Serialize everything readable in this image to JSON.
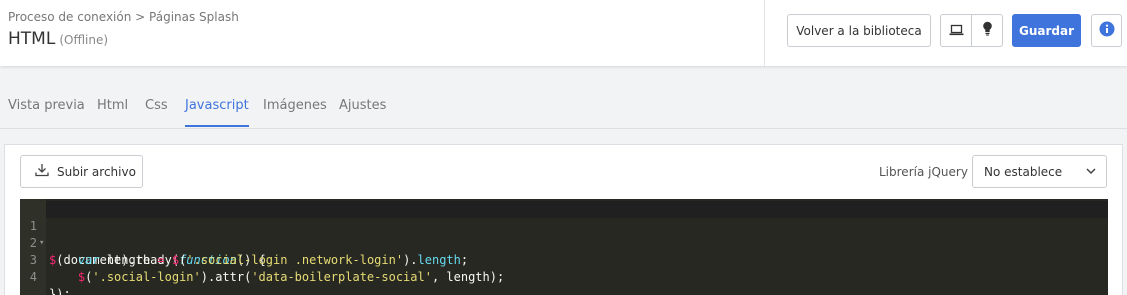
{
  "header": {
    "breadcrumb": "Proceso de conexión > Páginas Splash",
    "title": "HTML",
    "subtitle": "(Offline)",
    "library_button": "Volver a la biblioteca",
    "save_button": "Guardar",
    "icons": [
      "laptop-icon",
      "lightbulb-icon",
      "info-icon"
    ]
  },
  "tabs": [
    {
      "label": "Vista previa",
      "active": false
    },
    {
      "label": "Html",
      "active": false
    },
    {
      "label": "Css",
      "active": false
    },
    {
      "label": "Javascript",
      "active": true
    },
    {
      "label": "Imágenes",
      "active": false
    },
    {
      "label": "Ajustes",
      "active": false
    }
  ],
  "toolbar": {
    "upload_label": "Subir archivo",
    "jquery_label": "Librería jQuery",
    "jquery_selected": "No establece"
  },
  "editor": {
    "line_numbers": [
      "1",
      "2",
      "3",
      "4"
    ],
    "lines": [
      "$(document).ready(function() {",
      "    var length = $('.social-login .network-login').length;",
      "    $('.social-login').attr('data-boilerplate-social', length);",
      "});"
    ]
  },
  "colors": {
    "accent": "#3f74dc",
    "editor_bg": "#272822"
  }
}
